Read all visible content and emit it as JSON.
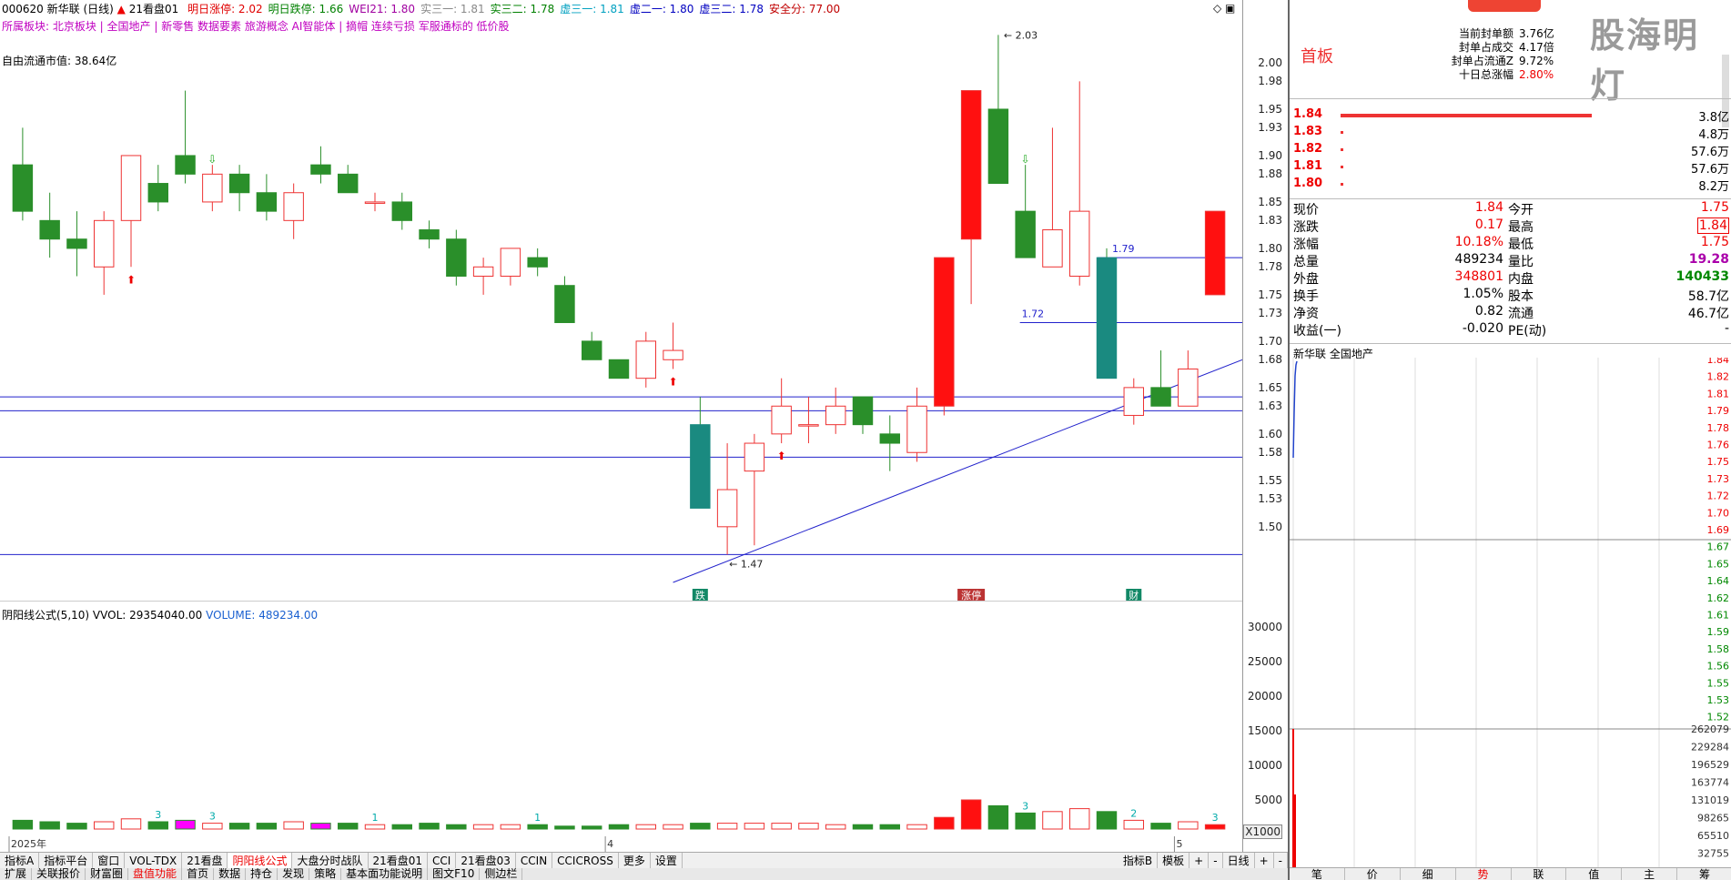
{
  "header": {
    "code_name": "000620 新华联 (日线)",
    "indicator_name": "21看盘01",
    "items": [
      {
        "label": "明日涨停: 2.02",
        "color": "#e00000"
      },
      {
        "label": "明日跌停: 1.66",
        "color": "#008000"
      },
      {
        "label": "WEI21: 1.80",
        "color": "#a000a0"
      },
      {
        "label": "实三一: 1.81",
        "color": "#888888"
      },
      {
        "label": "实三二: 1.78",
        "color": "#008000"
      },
      {
        "label": "虚三一: 1.81",
        "color": "#00a0c0"
      },
      {
        "label": "虚二一: 1.80",
        "color": "#0000c0"
      },
      {
        "label": "虚三二: 1.78",
        "color": "#0000c0"
      },
      {
        "label": "安全分: 77.00",
        "color": "#c00000"
      }
    ],
    "sector_line": "所属板块: 北京板块 | 全国地产 | 新零售 数据要素 旅游概念 AI智能体 | 摘帽 连续亏损 军服通标的 低价股",
    "float_cap": "自由流通市值: 38.64亿"
  },
  "kline": {
    "price_axis": [
      "2.00",
      "1.98",
      "1.95",
      "1.93",
      "1.90",
      "1.88",
      "1.85",
      "1.83",
      "1.80",
      "1.78",
      "1.75",
      "1.73",
      "1.70",
      "1.68",
      "1.65",
      "1.63",
      "1.60",
      "1.58",
      "1.55",
      "1.53",
      "1.50"
    ],
    "ymin": 1.44,
    "ymax": 2.05,
    "candles": [
      [
        1.89,
        1.93,
        1.83,
        1.84
      ],
      [
        1.83,
        1.86,
        1.79,
        1.81
      ],
      [
        1.81,
        1.84,
        1.77,
        1.8
      ],
      [
        1.78,
        1.84,
        1.75,
        1.83
      ],
      [
        1.83,
        1.87,
        1.78,
        1.9
      ],
      [
        1.87,
        1.89,
        1.84,
        1.85
      ],
      [
        1.9,
        1.97,
        1.87,
        1.88
      ],
      [
        1.85,
        1.89,
        1.84,
        1.88
      ],
      [
        1.88,
        1.89,
        1.84,
        1.86
      ],
      [
        1.86,
        1.88,
        1.83,
        1.84
      ],
      [
        1.83,
        1.87,
        1.81,
        1.86
      ],
      [
        1.89,
        1.91,
        1.87,
        1.88
      ],
      [
        1.88,
        1.89,
        1.86,
        1.86
      ],
      [
        1.85,
        1.86,
        1.84,
        1.85
      ],
      [
        1.85,
        1.86,
        1.82,
        1.83
      ],
      [
        1.82,
        1.83,
        1.8,
        1.81
      ],
      [
        1.81,
        1.82,
        1.76,
        1.77
      ],
      [
        1.77,
        1.79,
        1.75,
        1.78
      ],
      [
        1.77,
        1.8,
        1.76,
        1.8
      ],
      [
        1.79,
        1.8,
        1.77,
        1.78
      ],
      [
        1.76,
        1.77,
        1.72,
        1.72
      ],
      [
        1.7,
        1.71,
        1.68,
        1.68
      ],
      [
        1.68,
        1.68,
        1.66,
        1.66
      ],
      [
        1.66,
        1.71,
        1.65,
        1.7
      ],
      [
        1.68,
        1.72,
        1.67,
        1.69
      ],
      [
        1.61,
        1.64,
        1.52,
        1.52
      ],
      [
        1.5,
        1.59,
        1.47,
        1.54
      ],
      [
        1.56,
        1.6,
        1.48,
        1.59
      ],
      [
        1.6,
        1.66,
        1.59,
        1.63
      ],
      [
        1.61,
        1.64,
        1.59,
        1.61
      ],
      [
        1.61,
        1.65,
        1.6,
        1.63
      ],
      [
        1.64,
        1.64,
        1.6,
        1.61
      ],
      [
        1.6,
        1.62,
        1.56,
        1.59
      ],
      [
        1.58,
        1.65,
        1.57,
        1.63
      ],
      [
        1.63,
        1.79,
        1.62,
        1.79
      ],
      [
        1.81,
        1.97,
        1.74,
        1.97
      ],
      [
        1.95,
        2.03,
        1.88,
        1.87
      ],
      [
        1.84,
        1.89,
        1.79,
        1.79
      ],
      [
        1.78,
        1.93,
        1.78,
        1.82
      ],
      [
        1.77,
        1.98,
        1.76,
        1.84
      ],
      [
        1.79,
        1.8,
        1.66,
        1.66
      ],
      [
        1.62,
        1.66,
        1.61,
        1.65
      ],
      [
        1.65,
        1.69,
        1.63,
        1.63
      ],
      [
        1.63,
        1.69,
        1.63,
        1.67
      ],
      [
        1.75,
        1.84,
        1.75,
        1.84
      ]
    ],
    "annotations": {
      "high": "2.03",
      "low": "1.47",
      "level1": "1.79",
      "level2": "1.72"
    },
    "event_tags": [
      {
        "label": "跌",
        "index": 25
      },
      {
        "label": "涨停",
        "index": 35
      },
      {
        "label": "财",
        "index": 41
      }
    ],
    "hlines": [
      1.64,
      1.625,
      1.575,
      1.47
    ],
    "date_labels": [
      {
        "label": "2025年",
        "index": 0
      },
      {
        "label": "4",
        "index": 22
      },
      {
        "label": "5",
        "index": 43
      }
    ]
  },
  "volume": {
    "title": "阴阳线公式(5,10)",
    "vvol": "VVOL: 29354040.00",
    "volume": "VOLUME: 489234.00",
    "axis": [
      "30000",
      "25000",
      "20000",
      "15000",
      "10000",
      "5000"
    ],
    "scale": "X1000",
    "counts": [
      "3",
      "3",
      "1",
      "1",
      "3",
      "2",
      "3"
    ]
  },
  "tabs1": [
    "指标A",
    "指标平台",
    "窗口",
    "VOL-TDX",
    "21看盘",
    "阴阳线公式",
    "大盘分时战队",
    "21看盘01",
    "CCI",
    "21看盘03",
    "CCIN",
    "CCICROSS",
    "更多",
    "设置"
  ],
  "tabs1_right": [
    "指标B",
    "模板",
    "+",
    "-",
    "日线",
    "+",
    "-"
  ],
  "tabs2": [
    "扩展",
    "关联报价",
    "财富圈",
    "盘值功能",
    "首页",
    "数据",
    "持仓",
    "发现",
    "策略",
    "基本面功能说明",
    "图文F10",
    "侧边栏"
  ],
  "right": {
    "stamp": "首板",
    "seal": [
      {
        "label": "当前封单额",
        "value": "3.76亿"
      },
      {
        "label": "封单占成交",
        "value": "4.17倍"
      },
      {
        "label": "封单占流通Z",
        "value": "9.72%"
      },
      {
        "label": "十日总涨幅",
        "value": "2.80%"
      }
    ],
    "bids": [
      {
        "price": "1.84",
        "vol": "3.8亿"
      },
      {
        "price": "1.83",
        "vol": "4.8万"
      },
      {
        "price": "1.82",
        "vol": "57.6万"
      },
      {
        "price": "1.81",
        "vol": "57.6万"
      },
      {
        "price": "1.80",
        "vol": "8.2万"
      }
    ],
    "quotes": [
      [
        "现价",
        "1.84",
        "今开",
        "1.75"
      ],
      [
        "涨跌",
        "0.17",
        "最高",
        "1.84"
      ],
      [
        "涨幅",
        "10.18%",
        "最低",
        "1.75"
      ],
      [
        "总量",
        "489234",
        "量比",
        "19.28"
      ],
      [
        "外盘",
        "348801",
        "内盘",
        "140433"
      ],
      [
        "换手",
        "1.05%",
        "股本",
        "58.7亿"
      ],
      [
        "净资",
        "0.82",
        "流通",
        "46.7亿"
      ],
      [
        "收益(一)",
        "-0.020",
        "PE(动)",
        "-"
      ]
    ],
    "mini_title": "新华联  全国地产",
    "mini_axis": [
      "1.84",
      "1.82",
      "1.81",
      "1.79",
      "1.78",
      "1.76",
      "1.75",
      "1.73",
      "1.72",
      "1.70",
      "1.69",
      "1.67",
      "1.65",
      "1.64",
      "1.62",
      "1.61",
      "1.59",
      "1.58",
      "1.56",
      "1.55",
      "1.53",
      "1.52"
    ],
    "mini_vol_axis": [
      "262079",
      "229284",
      "196529",
      "163774",
      "131019",
      "98265",
      "65510",
      "32755"
    ],
    "bottom_tabs": [
      "笔",
      "价",
      "细",
      "势",
      "联",
      "值",
      "主",
      "筹"
    ],
    "watermark": "股海明灯"
  }
}
